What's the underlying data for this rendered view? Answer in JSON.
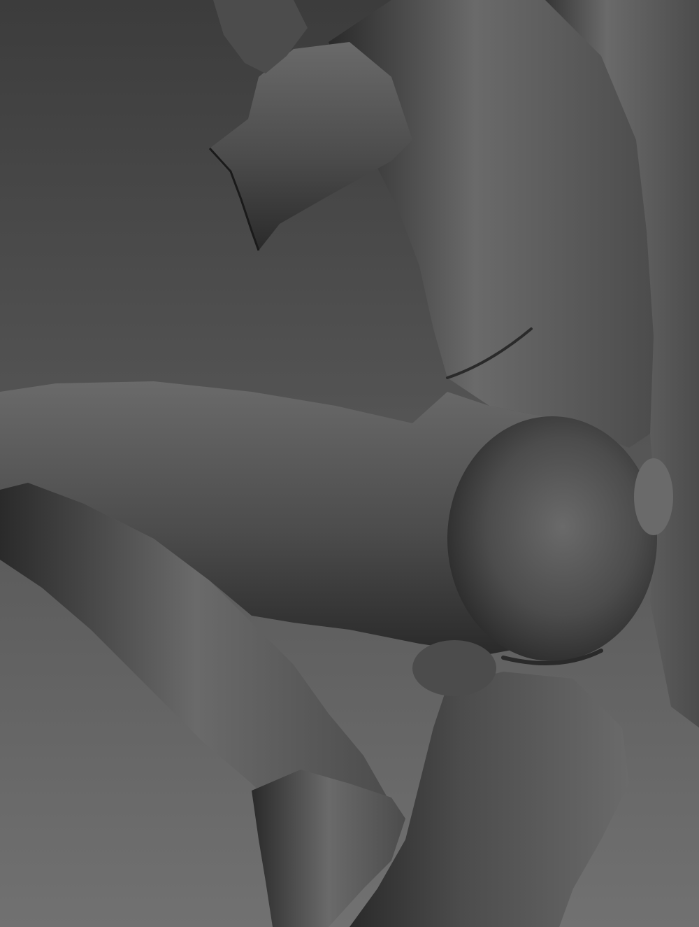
{
  "scene": {
    "background_gradient": {
      "top": "#3c3c3c",
      "bottom": "#717171"
    },
    "material": {
      "base": "#4c4c4c",
      "highlight": "#6a6a6a",
      "shadow": "#2a2a2a",
      "edge": "#1a1a1a"
    }
  }
}
